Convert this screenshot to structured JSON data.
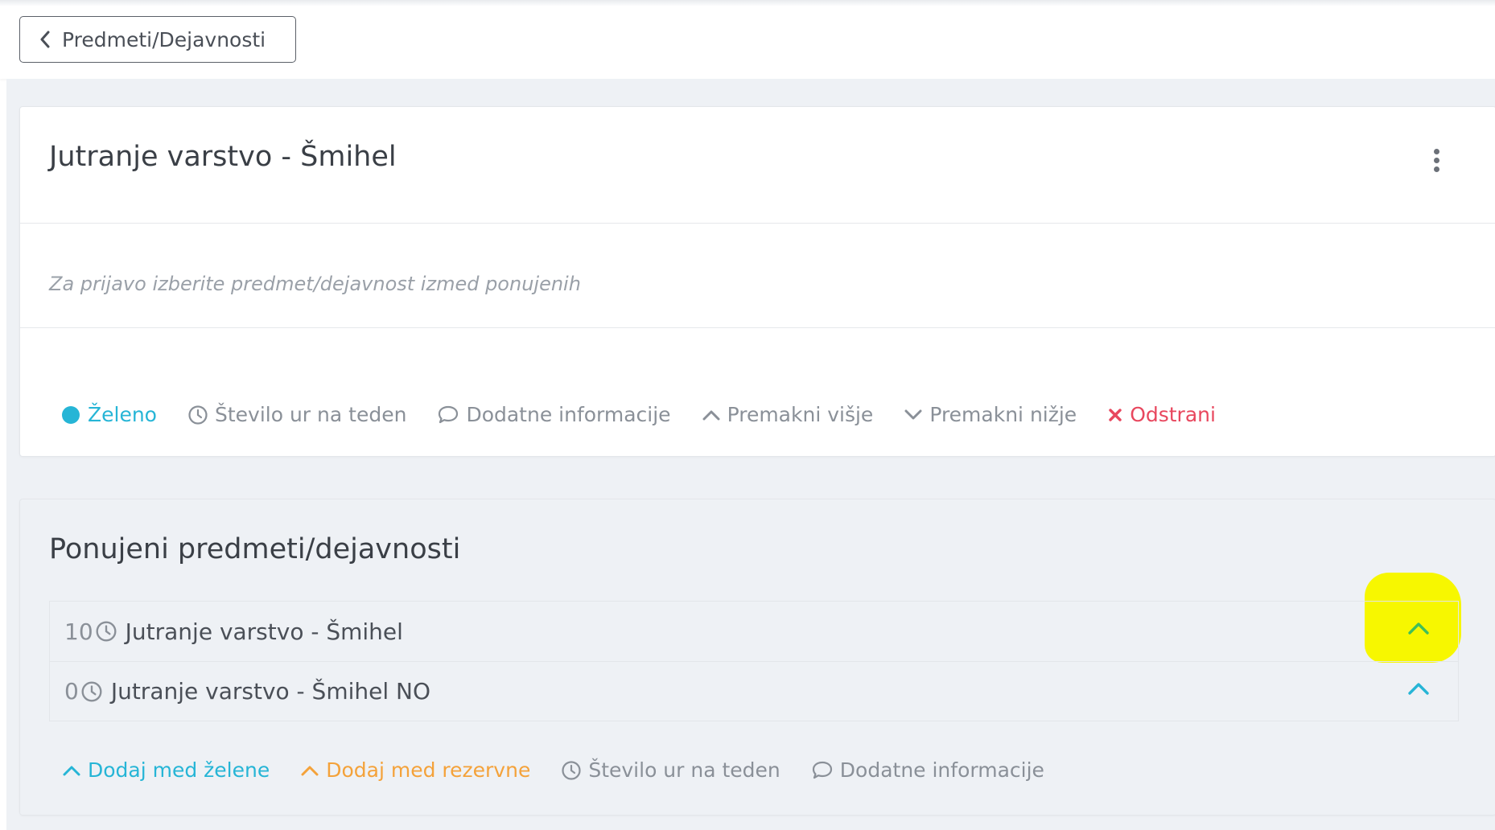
{
  "header": {
    "back_label": "Predmeti/Dejavnosti"
  },
  "selected_card": {
    "title": "Jutranje varstvo - Šmihel",
    "hint": "Za prijavo izberite predmet/dejavnost izmed ponujenih",
    "actions": {
      "status": "Želeno",
      "hours": "Število ur na teden",
      "info": "Dodatne informacije",
      "move_up": "Premakni višje",
      "move_down": "Premakni nižje",
      "remove": "Odstrani"
    }
  },
  "offered_card": {
    "title": "Ponujeni predmeti/dejavnosti",
    "items": [
      {
        "count": "10",
        "label": "Jutranje varstvo - Šmihel"
      },
      {
        "count": "0",
        "label": "Jutranje varstvo - Šmihel NO"
      }
    ],
    "legend": {
      "add_wanted": "Dodaj med želene",
      "add_reserve": "Dodaj med rezervne",
      "hours": "Število ur na teden",
      "info": "Dodatne informacije"
    }
  },
  "colors": {
    "accent_teal": "#26b5d6",
    "danger_red": "#e8475e",
    "reserve_orange": "#f4a23a",
    "chevron_green": "#3fbf5a",
    "highlight_yellow": "#f7f700"
  },
  "icons": [
    "chevron-left-icon",
    "kebab-menu-icon",
    "status-dot-icon",
    "clock-icon",
    "comment-icon",
    "chevron-up-icon",
    "chevron-down-icon",
    "close-icon"
  ]
}
